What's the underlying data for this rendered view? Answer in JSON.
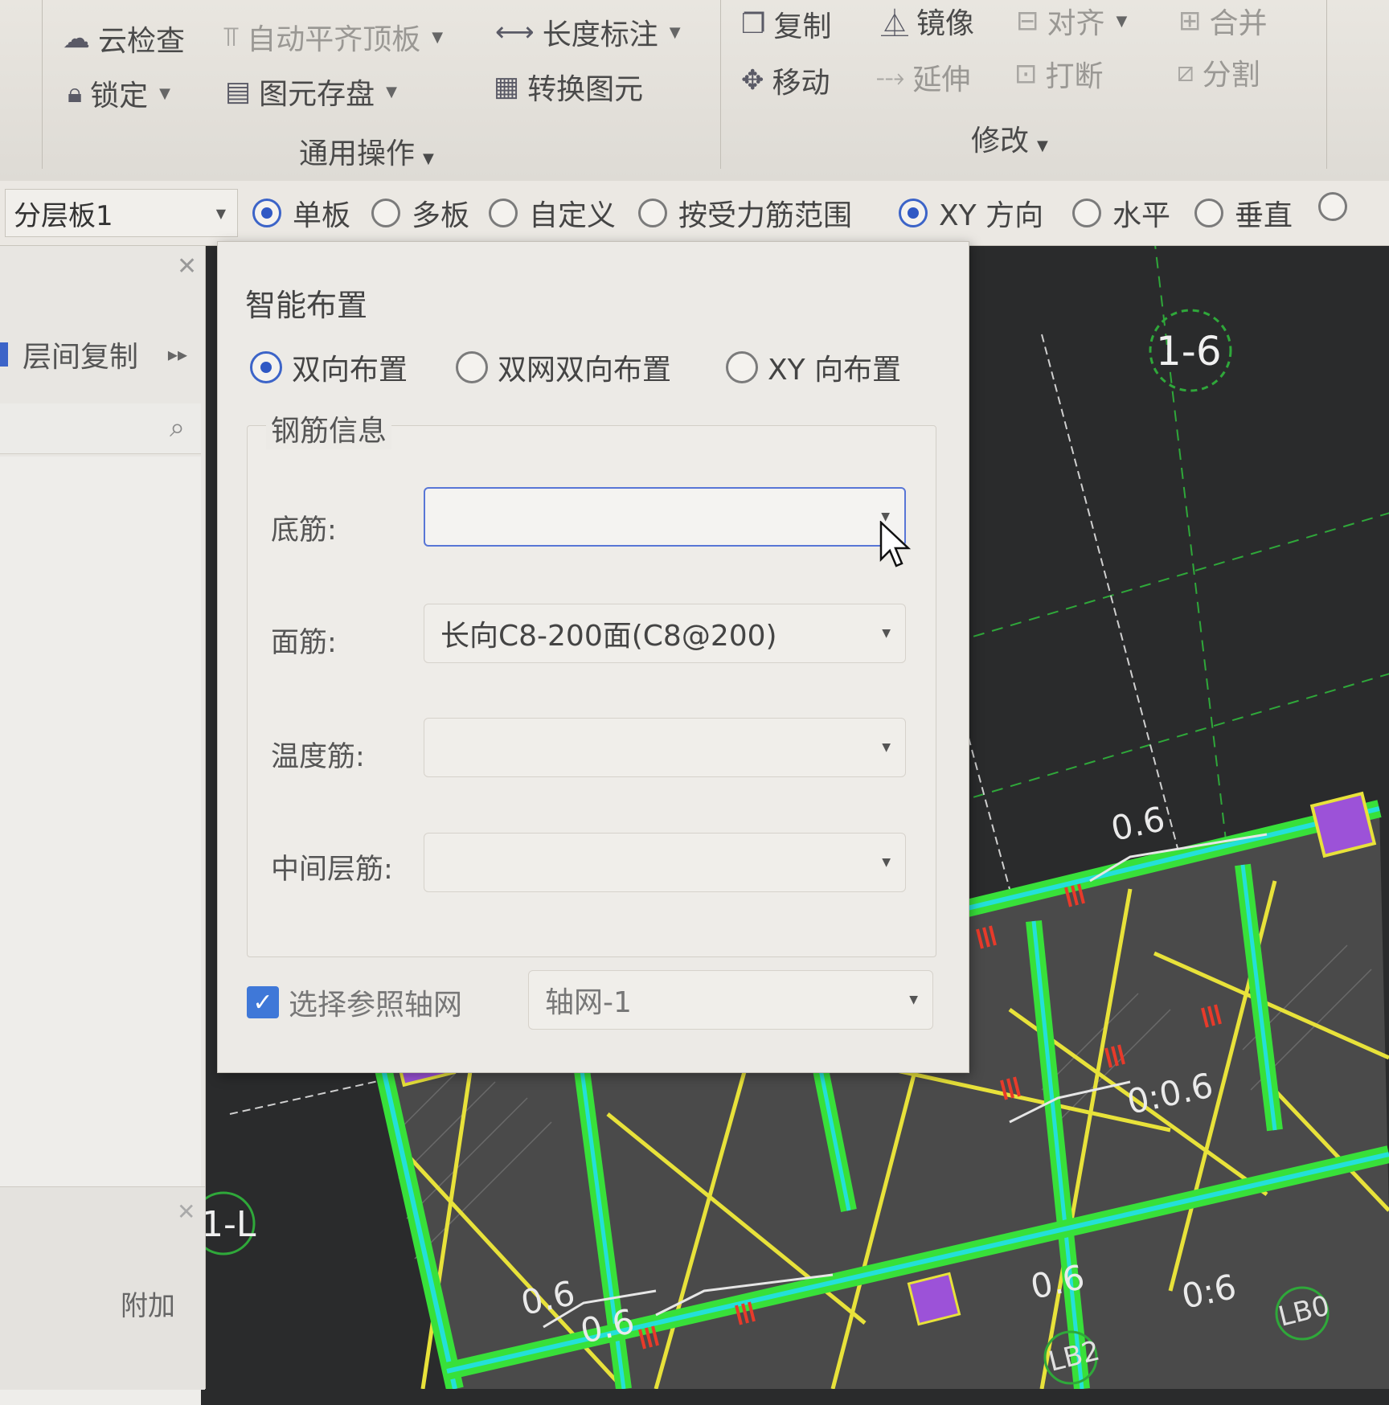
{
  "ribbon": {
    "cloud_check": "云检查",
    "auto_align_top": "自动平齐顶板",
    "length_dim": "长度标注",
    "lock": "锁定",
    "element_save": "图元存盘",
    "convert_element": "转换图元",
    "general_group": "通用操作",
    "copy": "复制",
    "mirror": "镜像",
    "align": "对齐",
    "merge": "合并",
    "move": "移动",
    "extend": "延伸",
    "break": "打断",
    "split": "分割",
    "modify_group": "修改"
  },
  "options_bar": {
    "layer": "分层板1",
    "single_board": "单板",
    "multi_board": "多板",
    "custom": "自定义",
    "by_force_range": "按受力筋范围",
    "xy_direction": "XY 方向",
    "horizontal": "水平",
    "vertical": "垂直",
    "selected_mode": "单板",
    "selected_direction": "XY 方向"
  },
  "left_panel": {
    "tab_label": "层间复制",
    "bottom_col_b": "附加"
  },
  "dialog": {
    "title": "智能布置",
    "layout_options": [
      "双向布置",
      "双网双向布置",
      "XY 向布置"
    ],
    "selected_layout": "双向布置",
    "group_title": "钢筋信息",
    "fields": {
      "bottom": {
        "label": "底筋:",
        "value": ""
      },
      "top": {
        "label": "面筋:",
        "value": "长向C8-200面(C8@200)"
      },
      "temperature": {
        "label": "温度筋:",
        "value": ""
      },
      "middle": {
        "label": "中间层筋:",
        "value": ""
      }
    },
    "ref_grid_checkbox": {
      "label": "选择参照轴网",
      "checked": true
    },
    "ref_grid_value": "轴网-1"
  },
  "canvas": {
    "axis_label": "1-6",
    "axis_label_left": "1-L",
    "slab_labels": [
      "0.6",
      "0.6",
      "0.6",
      "0:0.6",
      "0.6",
      "0:6",
      "0.6"
    ],
    "beam_labels": [
      "LB2",
      "LB0"
    ]
  },
  "colors": {
    "canvas_bg": "#2a2b2c",
    "beam_green": "#38e03a",
    "beam_cyan": "#24e0d8",
    "rebar_yellow": "#e8e23a",
    "column_purple": "#9c52d8",
    "rebar_red": "#e83a2a",
    "axis_green": "#2fa83a",
    "accent_blue": "#3c64c8"
  }
}
